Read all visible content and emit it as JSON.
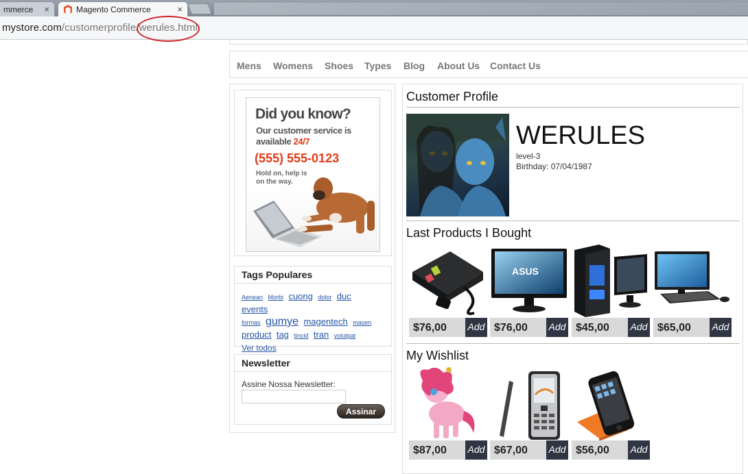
{
  "browser": {
    "tab_left": "mmerce",
    "tab_active": "Magento Commerce",
    "close_glyph": "×",
    "url_domain": "mystore.com",
    "url_path": "/customerprofile/werules.html",
    "highlight_color": "#d0202a"
  },
  "nav": {
    "items": [
      "Mens",
      "Womens",
      "Shoes",
      "Types",
      "Blog",
      "About Us",
      "Contact Us"
    ]
  },
  "ad": {
    "heading": "Did you know?",
    "line1": "Our customer service is",
    "line2_prefix": "available ",
    "line2_highlight": "24/7",
    "phone": "(555) 555-0123",
    "small1": "Hold on, help is",
    "small2": "on the way."
  },
  "tags": {
    "title": "Tags Populares",
    "items": [
      "Aenean",
      "Morbi",
      "cuong",
      "dolor",
      "duc",
      "events",
      "formas",
      "gumye",
      "magentech",
      "masen",
      "product",
      "tag",
      "tincid",
      "tran",
      "volutpat"
    ],
    "more": "Ver todos"
  },
  "newsletter": {
    "title": "Newsletter",
    "label": "Assine Nossa Newsletter:",
    "value": "",
    "button": "Assinar"
  },
  "profile": {
    "title": "Customer Profile",
    "username": "WERULES",
    "level": "level-3",
    "birthday": "Birthday: 07/04/1987"
  },
  "bought": {
    "title": "Last Products I Bought",
    "add_label": "Add",
    "items": [
      {
        "name": "power-strip",
        "price": "$76,00"
      },
      {
        "name": "asus-monitor",
        "price": "$76,00"
      },
      {
        "name": "desktop-pc",
        "price": "$45,00"
      },
      {
        "name": "all-in-one-pc",
        "price": "$65,00"
      }
    ]
  },
  "wishlist": {
    "title": "My Wishlist",
    "add_label": "Add",
    "items": [
      {
        "name": "pony-toy",
        "price": "$87,00"
      },
      {
        "name": "nokia-phone",
        "price": "$67,00"
      },
      {
        "name": "iphone",
        "price": "$56,00"
      }
    ]
  }
}
